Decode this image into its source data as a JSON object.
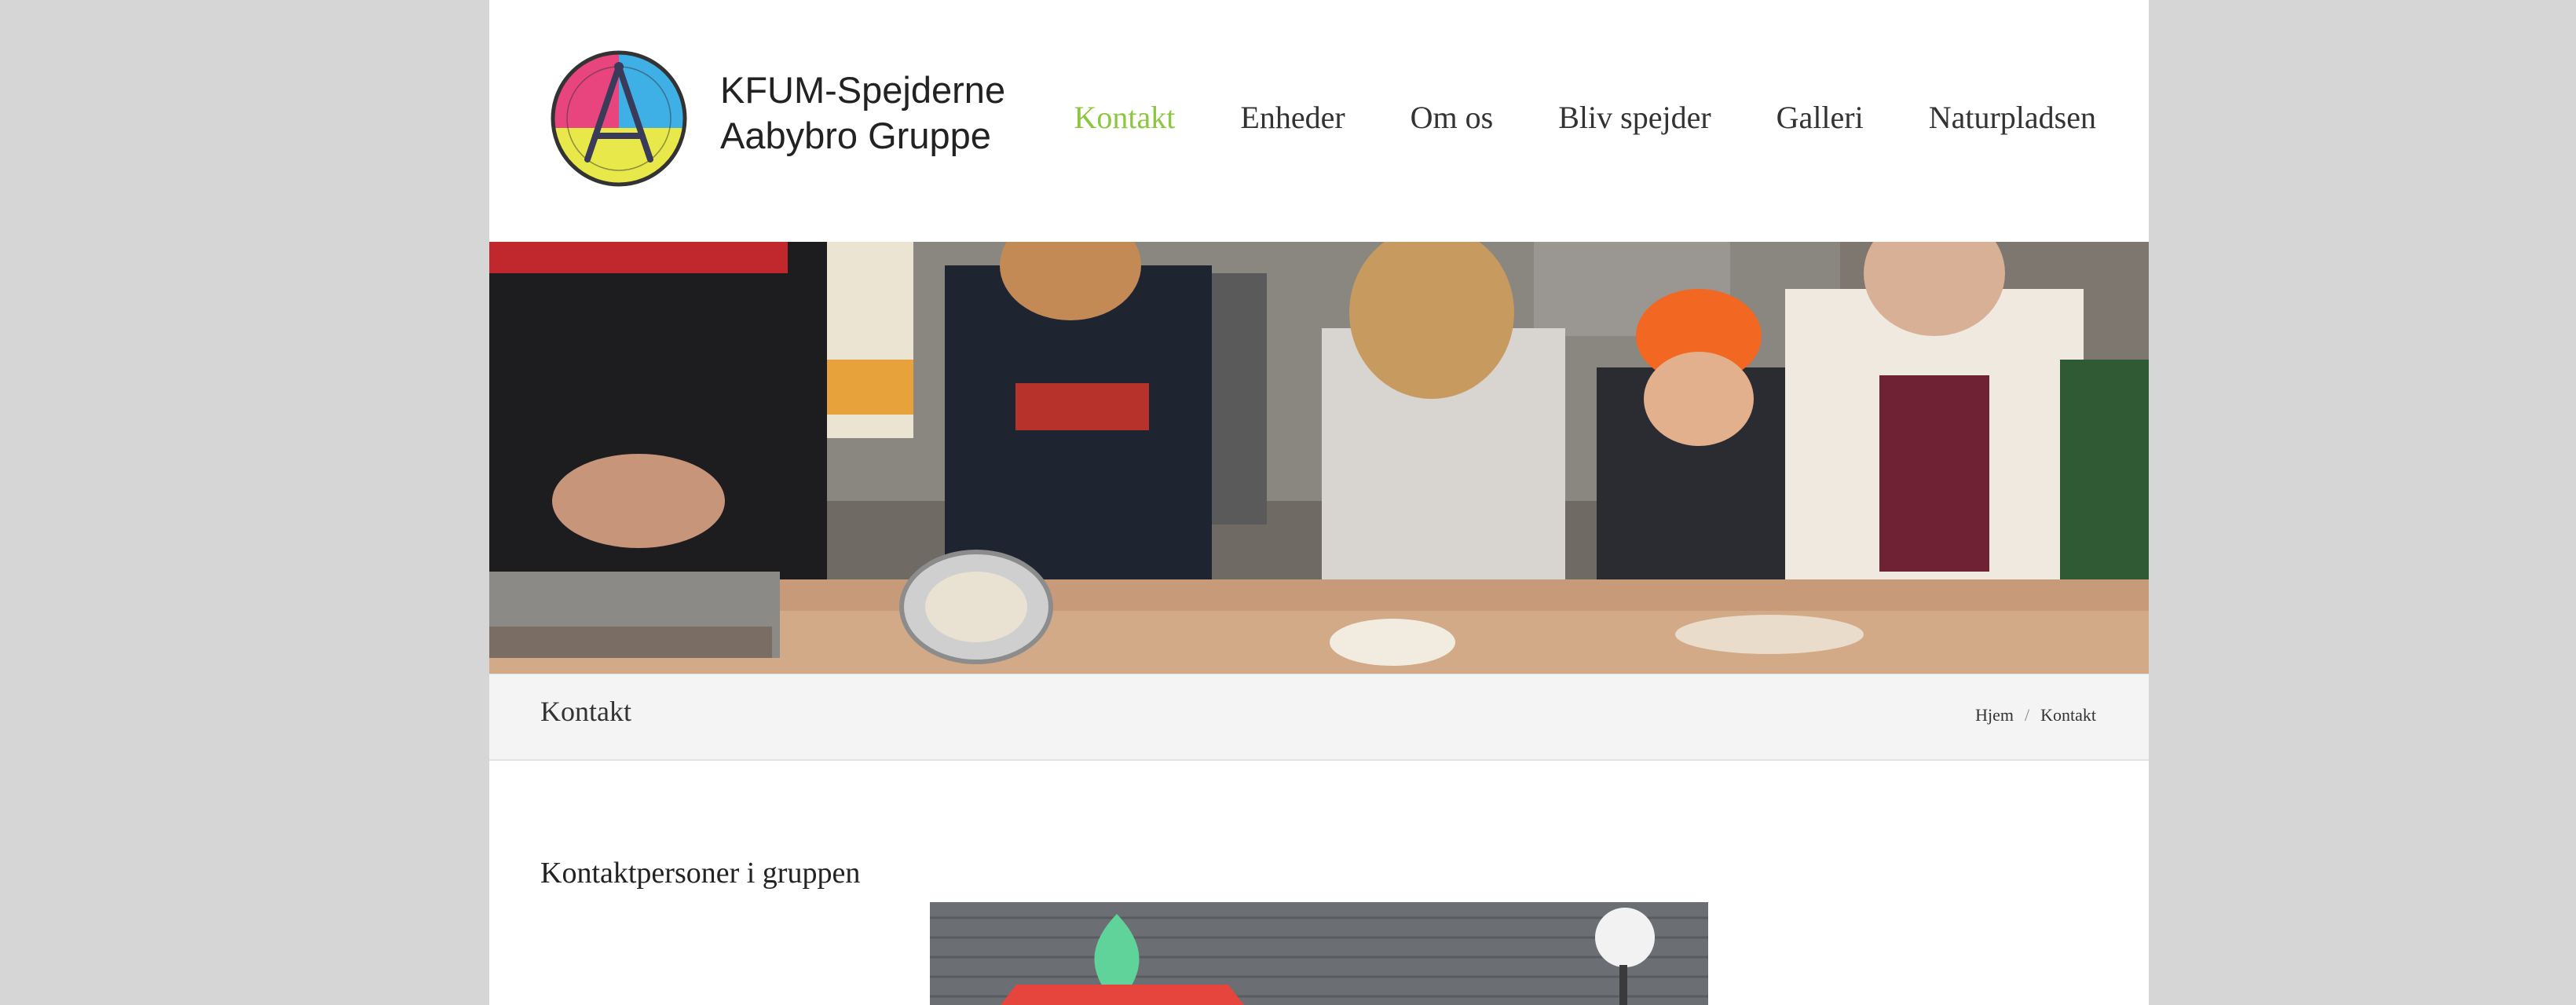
{
  "header": {
    "logo_line1": "KFUM-Spejderne",
    "logo_line2": "Aabybro Gruppe"
  },
  "nav": {
    "items": [
      "Kontakt",
      "Enheder",
      "Om os",
      "Bliv spejder",
      "Galleri",
      "Naturpladsen"
    ],
    "active": "Kontakt",
    "active_color": "#8dc63f"
  },
  "hero": {
    "description_icon": "hero-photo"
  },
  "titlebar": {
    "title": "Kontakt",
    "breadcrumb_home": "Hjem",
    "breadcrumb_sep": "/",
    "breadcrumb_current": "Kontakt"
  },
  "content": {
    "heading": "Kontaktpersoner i gruppen"
  }
}
